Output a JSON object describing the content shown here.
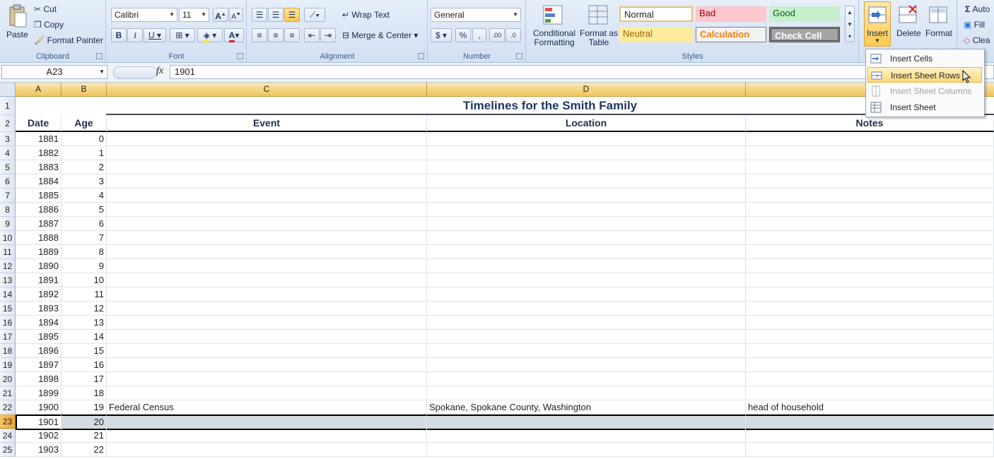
{
  "ribbon": {
    "clipboard": {
      "label": "Clipboard",
      "paste": "Paste",
      "cut": "Cut",
      "copy": "Copy",
      "format_painter": "Format Painter"
    },
    "font": {
      "label": "Font",
      "family": "Calibri",
      "size": "11"
    },
    "alignment": {
      "label": "Alignment",
      "wrap_text": "Wrap Text",
      "merge_center": "Merge & Center"
    },
    "number": {
      "label": "Number",
      "format": "General"
    },
    "styles": {
      "label": "Styles",
      "conditional_formatting": "Conditional Formatting",
      "format_as_table": "Format as Table",
      "cells": [
        "Normal",
        "Bad",
        "Good",
        "Neutral",
        "Calculation",
        "Check Cell"
      ]
    },
    "cells": {
      "insert": "Insert",
      "delete": "Delete",
      "format": "Format"
    },
    "editing": {
      "autosum": "Auto",
      "fill": "Fill",
      "clear": "Clea"
    }
  },
  "formula_bar": {
    "name_box": "A23",
    "fx": "fx",
    "value": "1901"
  },
  "sheet": {
    "columns": [
      "A",
      "B",
      "C",
      "D"
    ],
    "title": "Timelines for the Smith Family",
    "headers": [
      "Date",
      "Age",
      "Event",
      "Location",
      "Notes"
    ],
    "row_numbers": [
      "1",
      "2",
      "3",
      "4",
      "5",
      "6",
      "7",
      "8",
      "9",
      "10",
      "11",
      "12",
      "13",
      "14",
      "15",
      "16",
      "17",
      "18",
      "19",
      "20",
      "21",
      "22",
      "23",
      "24",
      "25"
    ],
    "rows": [
      [
        "1881",
        "0",
        "",
        "",
        ""
      ],
      [
        "1882",
        "1",
        "",
        "",
        ""
      ],
      [
        "1883",
        "2",
        "",
        "",
        ""
      ],
      [
        "1884",
        "3",
        "",
        "",
        ""
      ],
      [
        "1885",
        "4",
        "",
        "",
        ""
      ],
      [
        "1886",
        "5",
        "",
        "",
        ""
      ],
      [
        "1887",
        "6",
        "",
        "",
        ""
      ],
      [
        "1888",
        "7",
        "",
        "",
        ""
      ],
      [
        "1889",
        "8",
        "",
        "",
        ""
      ],
      [
        "1890",
        "9",
        "",
        "",
        ""
      ],
      [
        "1891",
        "10",
        "",
        "",
        ""
      ],
      [
        "1892",
        "11",
        "",
        "",
        ""
      ],
      [
        "1893",
        "12",
        "",
        "",
        ""
      ],
      [
        "1894",
        "13",
        "",
        "",
        ""
      ],
      [
        "1895",
        "14",
        "",
        "",
        ""
      ],
      [
        "1896",
        "15",
        "",
        "",
        ""
      ],
      [
        "1897",
        "16",
        "",
        "",
        ""
      ],
      [
        "1898",
        "17",
        "",
        "",
        ""
      ],
      [
        "1899",
        "18",
        "",
        "",
        ""
      ],
      [
        "1900",
        "19",
        "Federal Census",
        "Spokane, Spokane County, Washington",
        "head of household"
      ],
      [
        "1901",
        "20",
        "",
        "",
        ""
      ],
      [
        "1902",
        "21",
        "",
        "",
        ""
      ],
      [
        "1903",
        "22",
        "",
        "",
        ""
      ]
    ],
    "selected_row": "23"
  },
  "insert_menu": [
    "Insert Cells",
    "Insert Sheet Rows",
    "Insert Sheet Columns",
    "Insert Sheet"
  ],
  "colors": {
    "accent": "#ffd978",
    "title": "#1f3864"
  }
}
